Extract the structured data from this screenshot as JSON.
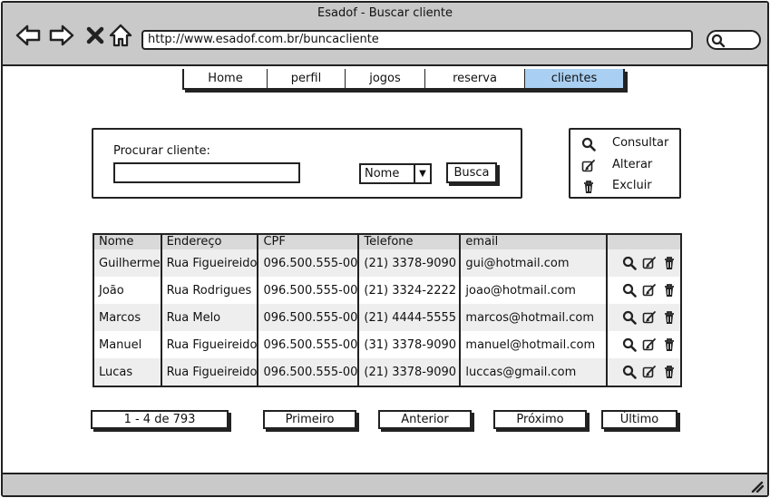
{
  "window": {
    "title": "Esadof - Buscar cliente"
  },
  "browser": {
    "url": "http://www.esadof.com.br/buncacliente",
    "nav_icons": [
      "back-arrow-icon",
      "forward-arrow-icon",
      "close-x-icon",
      "home-icon"
    ]
  },
  "tabs": [
    {
      "label": "Home",
      "active": false
    },
    {
      "label": "perfil",
      "active": false
    },
    {
      "label": "jogos",
      "active": false
    },
    {
      "label": "reserva",
      "active": false
    },
    {
      "label": "clientes",
      "active": true
    }
  ],
  "search": {
    "label": "Procurar cliente:",
    "input_value": "",
    "field_select": "Nome",
    "button_label": "Busca"
  },
  "actions_legend": [
    {
      "icon": "search-icon",
      "label": "Consultar"
    },
    {
      "icon": "edit-icon",
      "label": "Alterar"
    },
    {
      "icon": "trash-icon",
      "label": "Excluir"
    }
  ],
  "table": {
    "columns": [
      "Nome",
      "Endereço",
      "CPF",
      "Telefone",
      "email",
      ""
    ],
    "rows": [
      [
        "Guilherme",
        "Rua Figueireido",
        "096.500.555-00",
        "(21) 3378-9090",
        "gui@hotmail.com"
      ],
      [
        "João",
        "Rua Rodrigues",
        "096.500.555-00",
        "(21) 3324-2222",
        "joao@hotmail.com"
      ],
      [
        "Marcos",
        "Rua Melo",
        "096.500.555-00",
        "(21) 4444-5555",
        "marcos@hotmail.com"
      ],
      [
        "Manuel",
        "Rua Figueireido",
        "096.500.555-00",
        "(31) 3378-9090",
        "manuel@hotmail.com"
      ],
      [
        "Lucas",
        "Rua Figueireido",
        "096.500.555-00",
        "(21) 3378-9090",
        "luccas@gmail.com"
      ]
    ]
  },
  "pagination": {
    "range": "1 - 4 de 793",
    "first": "Primeiro",
    "prev": "Anterior",
    "next": "Próximo",
    "last": "Último"
  },
  "colors": {
    "chrome": "#c9c9c9",
    "active_tab": "#a9cff2",
    "row_alt": "#eeeeee"
  }
}
